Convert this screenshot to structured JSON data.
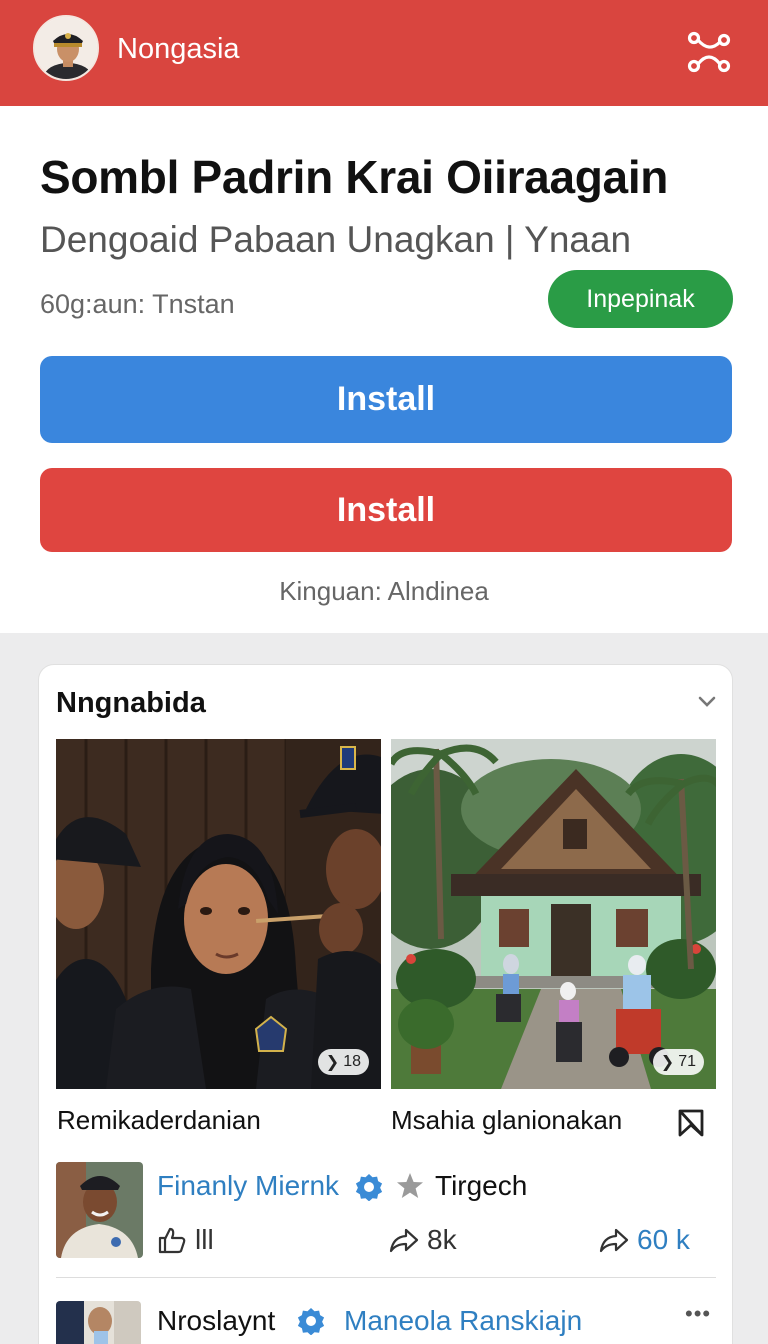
{
  "header": {
    "app_name": "Nongasia",
    "bg_color": "#d9453f"
  },
  "app": {
    "title": "Sombl Padrin Krai Oiiraagain",
    "subtitle": "Dengoaid Pabaan Unagkan | Ynaan",
    "meta": "60g:aun: Tnstan",
    "badge": "Inpepinak",
    "install_primary": "Install",
    "install_secondary": "Install",
    "footnote": "Kinguan: Alndinea"
  },
  "feed": {
    "title": "Nngnabida",
    "posts": [
      {
        "caption": "Remikaderdanian",
        "count": "18"
      },
      {
        "caption": "Msahia glanionakan",
        "count": "71"
      }
    ],
    "author": {
      "name": "Finanly Miernk",
      "tag": "Tirgech"
    },
    "actions": {
      "like": "lll",
      "share1": "8k",
      "share2": "60 k"
    },
    "next_author": {
      "name": "Nroslaynt",
      "org": "Maneola Ranskiajn"
    }
  },
  "icons": {
    "share": "share-nodes-icon",
    "chevron": "chevron-down-icon",
    "bookmark": "bookmark-icon",
    "verified": "verified-badge-icon",
    "star": "star-icon",
    "like": "thumbs-up-icon",
    "forward": "forward-arrow-icon",
    "more": "more-dots-icon"
  }
}
